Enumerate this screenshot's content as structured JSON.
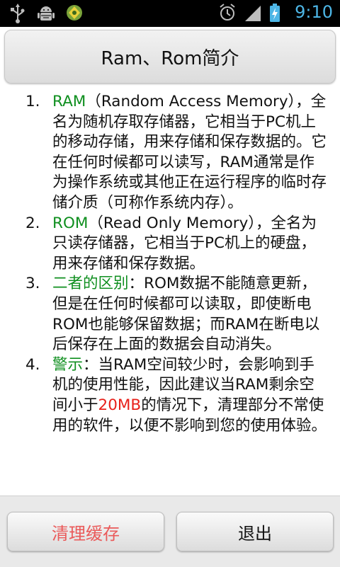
{
  "status_bar": {
    "time": "9:10",
    "left_icons": [
      "usb-icon",
      "android-debug-icon",
      "app-notification-icon"
    ],
    "right_icons": [
      "alarm-icon",
      "signal-icon",
      "battery-charging-icon"
    ]
  },
  "header": {
    "title": "Ram、Rom简介"
  },
  "list": {
    "items": [
      {
        "number": "1.",
        "term": "RAM",
        "text": "（Random Access Memory），全名为随机存取存储器，它相当于PC机上的移动存储，用来存储和保存数据的。它在任何时候都可以读写，RAM通常是作为操作系统或其他正在运行程序的临时存储介质（可称作系统内存）。"
      },
      {
        "number": "2.",
        "term": "ROM",
        "text": "（Read Only Memory），全名为只读存储器，它相当于PC机上的硬盘，用来存储和保存数据。"
      },
      {
        "number": "3.",
        "term": "二者的区别",
        "text": "：ROM数据不能随意更新，但是在任何时候都可以读取，即使断电ROM也能够保留数据；而RAM在断电以后保存在上面的数据会自动消失。"
      },
      {
        "number": "4.",
        "term": "警示",
        "text_before": "：当RAM空间较少时，会影响到手机的使用性能，因此建议当RAM剩余空间小于",
        "highlight": "20MB",
        "text_after": "的情况下，清理部分不常使用的软件，以便不影响到您的使用体验。"
      }
    ]
  },
  "buttons": {
    "clean_label": "清理缓存",
    "exit_label": "退出"
  },
  "colors": {
    "term_green": "#0f8f1f",
    "highlight_red": "#e8201a",
    "clean_button_text": "#ea5a5a",
    "status_time_blue": "#4db6e6"
  }
}
